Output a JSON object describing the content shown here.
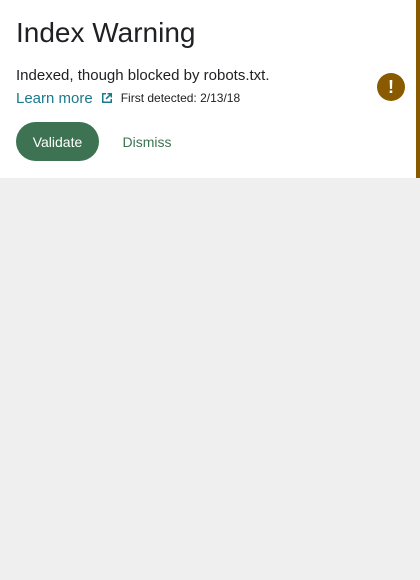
{
  "card": {
    "title": "Index Warning",
    "message": "Indexed, though blocked by robots.txt.",
    "learn_more": "Learn more",
    "learn_more_icon": "external-link-icon",
    "first_detected": "First detected: 2/13/18",
    "status_icon": "warning-icon",
    "status_symbol": "!",
    "status_color": "#8a5a00",
    "accent_color": "#8a5a00"
  },
  "actions": {
    "validate_label": "Validate",
    "dismiss_label": "Dismiss",
    "primary_color": "#3d7352"
  }
}
